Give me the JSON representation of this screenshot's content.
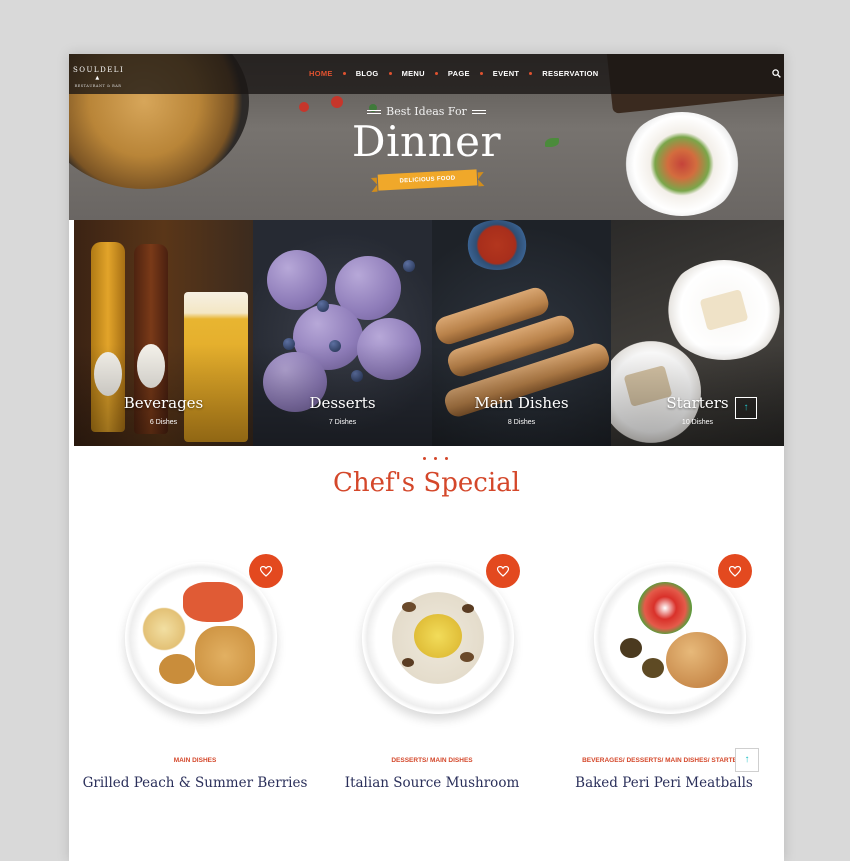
{
  "logo": {
    "name": "SOULDELI",
    "subtitle": "RESTAURANT & BAR"
  },
  "nav": {
    "items": [
      {
        "label": "HOME",
        "active": true
      },
      {
        "label": "BLOG",
        "active": false
      },
      {
        "label": "MENU",
        "active": false
      },
      {
        "label": "PAGE",
        "active": false
      },
      {
        "label": "EVENT",
        "active": false
      },
      {
        "label": "RESERVATION",
        "active": false
      }
    ],
    "search_icon": "search-icon"
  },
  "hero": {
    "kicker": "Best Ideas For",
    "title": "Dinner",
    "ribbon": "DELICIOUS FOOD"
  },
  "categories": [
    {
      "name": "Beverages",
      "count": "6 Dishes"
    },
    {
      "name": "Desserts",
      "count": "7 Dishes"
    },
    {
      "name": "Main Dishes",
      "count": "8 Dishes"
    },
    {
      "name": "Starters",
      "count": "10 Dishes"
    }
  ],
  "section": {
    "title": "Chef's Special"
  },
  "dishes": [
    {
      "tag": "MAIN DISHES",
      "name": "Grilled Peach & Summer Berries"
    },
    {
      "tag": "DESSERTS/ MAIN DISHES",
      "name": "Italian Source Mushroom"
    },
    {
      "tag": "BEVERAGES/ DESSERTS/ MAIN DISHES/ STARTERS",
      "name": "Baked Peri Peri Meatballs"
    }
  ],
  "colors": {
    "accent": "#e3491f",
    "title_red": "#d4472a",
    "dish_name": "#2a2f5a",
    "ribbon": "#f0a82a"
  },
  "icons": {
    "heart": "heart-icon",
    "arrow_up": "arrow-up-icon",
    "search": "search-icon"
  }
}
